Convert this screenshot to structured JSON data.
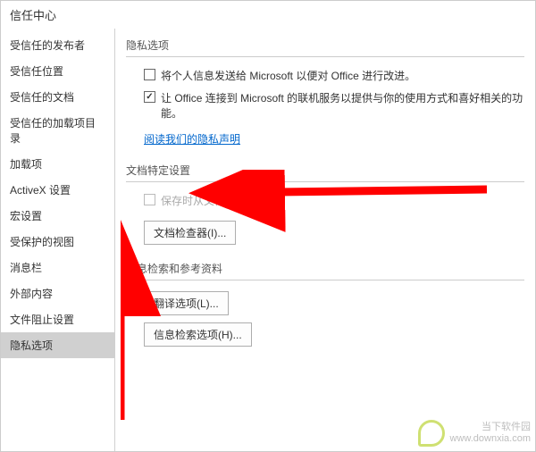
{
  "window": {
    "title": "信任中心"
  },
  "sidebar": {
    "items": [
      {
        "label": "受信任的发布者"
      },
      {
        "label": "受信任位置"
      },
      {
        "label": "受信任的文档"
      },
      {
        "label": "受信任的加载项目录"
      },
      {
        "label": "加载项"
      },
      {
        "label": "ActiveX 设置"
      },
      {
        "label": "宏设置"
      },
      {
        "label": "受保护的视图"
      },
      {
        "label": "消息栏"
      },
      {
        "label": "外部内容"
      },
      {
        "label": "文件阻止设置"
      },
      {
        "label": "隐私选项"
      }
    ],
    "selected_index": 11
  },
  "sections": {
    "privacy": {
      "title": "隐私选项",
      "check1": {
        "label": "将个人信息发送给 Microsoft 以便对 Office 进行改进。",
        "checked": false
      },
      "check2": {
        "label": "让 Office 连接到 Microsoft 的联机服务以提供与你的使用方式和喜好相关的功能。",
        "checked": true
      },
      "link": "阅读我们的隐私声明"
    },
    "docspec": {
      "title": "文档特定设置",
      "check1": {
        "label": "保存时从文件属性中删",
        "disabled": true
      },
      "button": "文档检查器(I)..."
    },
    "research": {
      "title": "信息检索和参考资料",
      "button1": "翻译选项(L)...",
      "button2": "信息检索选项(H)..."
    }
  },
  "watermark": {
    "name": "当下软件园",
    "url": "www.downxia.com"
  }
}
